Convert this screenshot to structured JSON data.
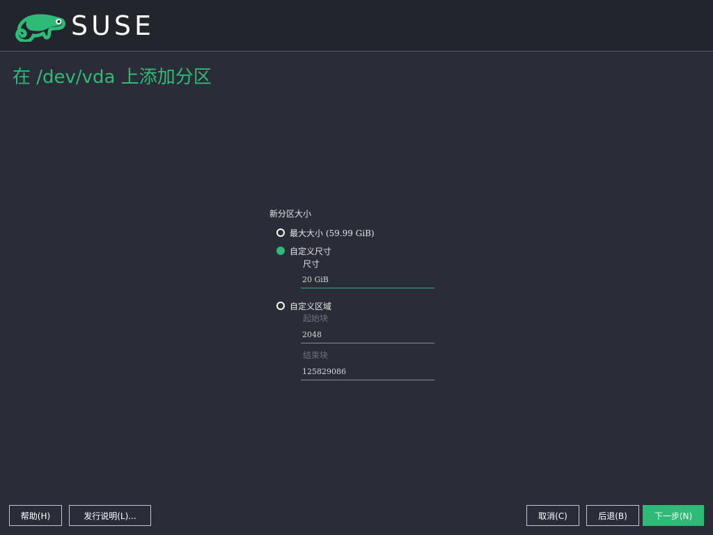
{
  "header": {
    "brand": "SUSE",
    "logo_icon": "suse-chameleon-logo",
    "brand_color": "#30ba78"
  },
  "page": {
    "title": "在 /dev/vda 上添加分区"
  },
  "form": {
    "group_label": "新分区大小",
    "options": {
      "max_size": {
        "label": "最大大小 (59.99 GiB)",
        "checked": false
      },
      "custom_size": {
        "label": "自定义尺寸",
        "checked": true
      },
      "custom_region": {
        "label": "自定义区域",
        "checked": false
      }
    },
    "size": {
      "label": "尺寸",
      "value": "20 GiB"
    },
    "start_block": {
      "label": "起始块",
      "value": "2048"
    },
    "end_block": {
      "label": "结束块",
      "value": "125829086"
    }
  },
  "footer": {
    "help": "帮助(H)",
    "release_notes": "发行说明(L)...",
    "cancel": "取消(C)",
    "back": "后退(B)",
    "next": "下一步(N)"
  }
}
